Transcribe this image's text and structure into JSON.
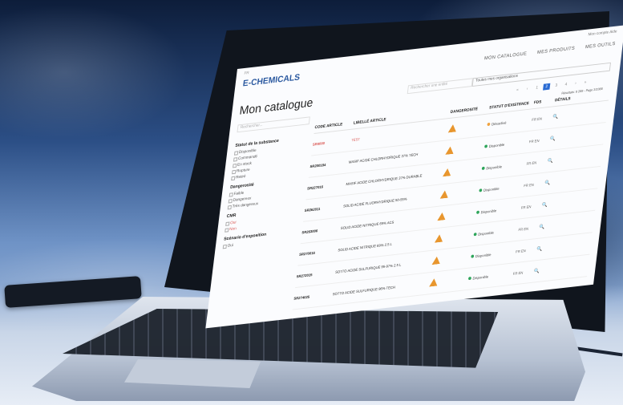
{
  "scene": {
    "description_colors": {
      "accent": "#2a6bd3",
      "danger": "#d9534f",
      "success": "#2da55a",
      "hazard": "#e8962e"
    }
  },
  "site": {
    "flag_label": "FR",
    "logo": "E-CHEMICALS",
    "top_links": "Mon compte  Aide",
    "menu": [
      "MON CATALOGUE",
      "MES PRODUITS",
      "MES OUTILS"
    ],
    "page_title": "Mon catalogue",
    "search_placeholder": "Rechercher...",
    "top_search_placeholder": "Rechercher une entité",
    "select_value": "Toutes mes organisations",
    "pager": [
      "«",
      "‹",
      "1",
      "2",
      "3",
      "4",
      "›",
      "»"
    ],
    "pager_active": "2",
    "pager_info": "Résultats: 8 288 - Page 2/2388"
  },
  "sidebar": {
    "sections": [
      {
        "title": "Statut de la substance",
        "items": [
          "Disponible",
          "Commandé",
          "En stock",
          "Rupture",
          "Retiré"
        ]
      },
      {
        "title": "Dangerosité",
        "items": [
          "Faible",
          "Dangereux",
          "Très dangereux"
        ]
      },
      {
        "title": "CMR",
        "items": [
          "Oui",
          "Non"
        ],
        "red": true
      },
      {
        "title": "Scénario d'exposition",
        "items": [
          "Oui"
        ]
      }
    ]
  },
  "table": {
    "headers": [
      "CODE ARTICLE",
      "LIBELLÉ ARTICLE",
      "DANGEROSITÉ",
      "STATUT D'EXISTENCE",
      "FDS",
      "DÉTAILS"
    ],
    "rows": [
      {
        "code": "SR0000",
        "label": "TEST",
        "status": "Désactivé",
        "status_color": "o",
        "fds": "FR EN",
        "red": true
      },
      {
        "code": "SR200184",
        "label": "MASIF ACIDE CHLORHYDRIQUE 37% TECH",
        "status": "Disponible",
        "fds": "FR EN"
      },
      {
        "code": "SR227016",
        "label": "MASIF ACIDE CHLORHYDRIQUE 37% DURABLE",
        "status": "Disponible",
        "fds": "FR EN"
      },
      {
        "code": "SR262011",
        "label": "SOLID ACIDE FLUORHYDRIQUE 50-55%",
        "status": "Disponible",
        "fds": "FR EN"
      },
      {
        "code": "SR263006",
        "label": "SOLID ACIDE NITRIQUE 65% ACS",
        "status": "Disponible",
        "fds": "FR EN"
      },
      {
        "code": "SR270016",
        "label": "SOLID ACIDE NITRIQUE 69% 2.5 L",
        "status": "Disponible",
        "fds": "FR EN"
      },
      {
        "code": "SR272015",
        "label": "SOTTO ACIDE SULFURIQUE 95-97% 2.5 L",
        "status": "Disponible",
        "fds": "FR EN"
      },
      {
        "code": "SR274025",
        "label": "SOTTO ACIDE SULFURIQUE 96% TECH",
        "status": "Disponible",
        "fds": "FR EN"
      }
    ],
    "details_icon": "search-icon"
  }
}
